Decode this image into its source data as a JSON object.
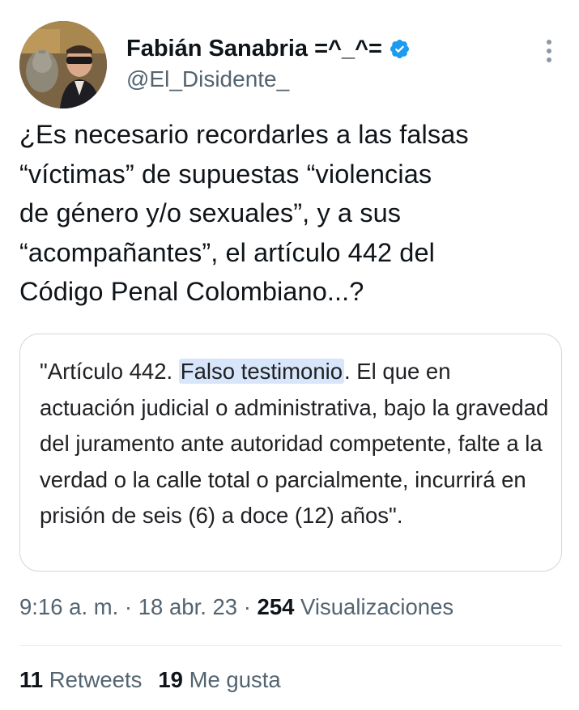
{
  "author": {
    "display_name": "Fabián Sanabria =^_^=",
    "handle": "@El_Disidente_",
    "verified": true,
    "avatar": "user-avatar-photo"
  },
  "tweet": {
    "text": "¿Es necesario recordarles a las falsas\n“víctimas” de supuestas “violencias\nde género y/o sexuales”, y a sus\n“acompañantes”, el artículo 442 del\nCódigo Penal Colombiano...?"
  },
  "quote": {
    "prefix": "\"Artículo 442. ",
    "highlight": "Falso testimonio",
    "suffix": ". El que en actuación judicial o administrativa, bajo la gravedad del juramento ante autoridad competente, falte a la verdad o la calle total o parcialmente, incurrirá en prisión de seis (6) a doce (12) años\"."
  },
  "meta": {
    "time": "9:16 a. m.",
    "separator": " · ",
    "date": "18 abr. 23",
    "views_count": "254",
    "views_label": " Visualizaciones"
  },
  "stats": {
    "retweets_count": "11",
    "retweets_label": " Retweets",
    "likes_count": "19",
    "likes_label": " Me gusta"
  },
  "colors": {
    "text_primary": "#0f1419",
    "text_secondary": "#536471",
    "verified_blue": "#1d9bf0",
    "highlight": "#d8e6fb",
    "border": "#cfd9de"
  },
  "icons": {
    "verified": "verified-badge-icon",
    "more": "more-options-icon"
  }
}
